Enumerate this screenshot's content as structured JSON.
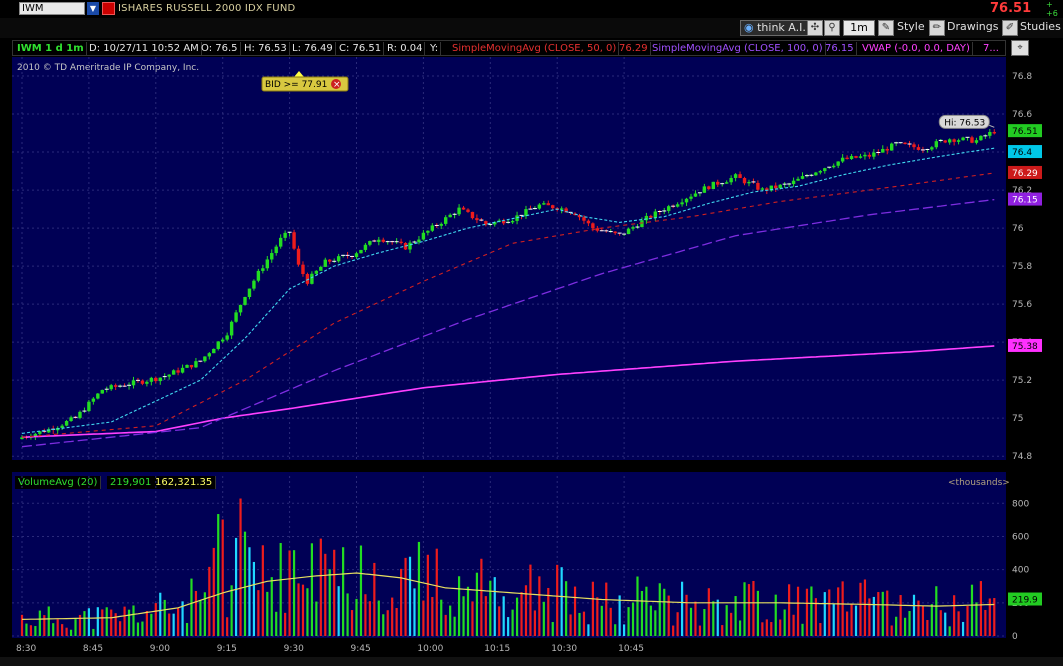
{
  "header": {
    "symbol": "IWM",
    "description": "ISHARES RUSSELL 2000 IDX FUND",
    "last_price": "76.51",
    "change_top": "+",
    "change_bottom": "+6"
  },
  "toolbar": {
    "think_label": "think A.I.",
    "timeframe": "1m",
    "style_label": "Style",
    "drawings_label": "Drawings",
    "studies_label": "Studies"
  },
  "infobar": {
    "aggregation": "IWM 1 d 1m",
    "date": "D: 10/27/11 10:52 AM",
    "open": "O: 76.5",
    "high": "H: 76.53",
    "low": "L: 76.49",
    "close": "C: 76.51",
    "range": "R: 0.04",
    "y": "Y:",
    "sma50_label": "SimpleMovingAvg (CLOSE, 50, 0)",
    "sma50_value": "76.29",
    "sma100_label": "SimpleMovingAvg (CLOSE, 100, 0)",
    "sma100_value": "76.15",
    "vwap_label": "VWAP (-0.0, 0.0, DAY)",
    "vwap_value": "7..."
  },
  "price_panel": {
    "copyright": "2010 © TD Ameritrade IP Company, Inc.",
    "alert_label": "BID >= 77.91",
    "hi_label": "Hi: 76.53",
    "tags": [
      {
        "text": "76.51",
        "price": 76.51,
        "bg": "#22cc22",
        "fg": "#000000"
      },
      {
        "text": "76.4",
        "price": 76.4,
        "bg": "#00c8e8",
        "fg": "#000000"
      },
      {
        "text": "76.29",
        "price": 76.29,
        "bg": "#cc1a1a",
        "fg": "#ffffff"
      },
      {
        "text": "76.15",
        "price": 76.15,
        "bg": "#9020e0",
        "fg": "#ffffff"
      },
      {
        "text": "75.38",
        "price": 75.38,
        "bg": "#ff30ff",
        "fg": "#000000"
      }
    ]
  },
  "volume_panel": {
    "study_label": "VolumeAvg (20)",
    "avg_value": "219,901",
    "volume_value": "162,321.35",
    "units_label": "<thousands>",
    "tag": {
      "text": "219.9",
      "value": 219.9
    }
  },
  "chart_data": {
    "type": "candlestick",
    "price_axis": {
      "ticks": [
        74.8,
        75,
        75.2,
        75.4,
        75.6,
        75.8,
        76,
        76.2,
        76.4,
        76.6,
        76.8
      ],
      "ylim": [
        74.78,
        76.9
      ]
    },
    "volume_axis": {
      "ticks": [
        0,
        200,
        400,
        600,
        800
      ],
      "ylim": [
        0,
        880
      ]
    },
    "time_ticks": [
      "8:30",
      "8:45",
      "9:00",
      "9:15",
      "9:30",
      "9:45",
      "10:00",
      "10:15",
      "10:30",
      "10:45"
    ],
    "bar_interval_minutes": 1,
    "first_bar_time": "8:30",
    "close_anchors": [
      [
        0,
        74.9
      ],
      [
        6,
        74.94
      ],
      [
        12,
        75.0
      ],
      [
        18,
        75.15
      ],
      [
        24,
        75.18
      ],
      [
        32,
        75.22
      ],
      [
        40,
        75.3
      ],
      [
        46,
        75.45
      ],
      [
        50,
        75.65
      ],
      [
        54,
        75.8
      ],
      [
        58,
        75.94
      ],
      [
        60,
        75.98
      ],
      [
        62,
        75.8
      ],
      [
        64,
        75.72
      ],
      [
        68,
        75.82
      ],
      [
        74,
        75.86
      ],
      [
        80,
        75.95
      ],
      [
        86,
        75.9
      ],
      [
        92,
        76.0
      ],
      [
        98,
        76.1
      ],
      [
        104,
        76.02
      ],
      [
        110,
        76.05
      ],
      [
        116,
        76.12
      ],
      [
        120,
        76.11
      ],
      [
        124,
        76.08
      ],
      [
        128,
        76.0
      ],
      [
        134,
        75.96
      ],
      [
        140,
        76.05
      ],
      [
        148,
        76.15
      ],
      [
        154,
        76.22
      ],
      [
        160,
        76.27
      ],
      [
        166,
        76.2
      ],
      [
        172,
        76.23
      ],
      [
        178,
        76.3
      ],
      [
        184,
        76.36
      ],
      [
        190,
        76.38
      ],
      [
        196,
        76.44
      ],
      [
        202,
        76.42
      ],
      [
        208,
        76.47
      ],
      [
        214,
        76.46
      ],
      [
        218,
        76.51
      ]
    ],
    "ema_anchors": [
      [
        0,
        74.92
      ],
      [
        20,
        74.98
      ],
      [
        40,
        75.2
      ],
      [
        50,
        75.42
      ],
      [
        60,
        75.68
      ],
      [
        70,
        75.8
      ],
      [
        80,
        75.87
      ],
      [
        90,
        75.93
      ],
      [
        100,
        76.0
      ],
      [
        110,
        76.05
      ],
      [
        120,
        76.1
      ],
      [
        126,
        76.06
      ],
      [
        134,
        76.03
      ],
      [
        144,
        76.06
      ],
      [
        154,
        76.13
      ],
      [
        164,
        76.19
      ],
      [
        174,
        76.22
      ],
      [
        184,
        76.28
      ],
      [
        194,
        76.33
      ],
      [
        204,
        76.37
      ],
      [
        212,
        76.4
      ],
      [
        218,
        76.42
      ]
    ],
    "sma50_anchors": [
      [
        0,
        74.9
      ],
      [
        30,
        74.96
      ],
      [
        50,
        75.2
      ],
      [
        70,
        75.5
      ],
      [
        90,
        75.72
      ],
      [
        110,
        75.92
      ],
      [
        130,
        76.0
      ],
      [
        150,
        76.06
      ],
      [
        170,
        76.14
      ],
      [
        190,
        76.2
      ],
      [
        218,
        76.29
      ]
    ],
    "sma100_anchors": [
      [
        0,
        74.85
      ],
      [
        40,
        74.95
      ],
      [
        70,
        75.25
      ],
      [
        100,
        75.52
      ],
      [
        130,
        75.76
      ],
      [
        160,
        75.96
      ],
      [
        190,
        76.07
      ],
      [
        218,
        76.15
      ]
    ],
    "vwap_anchors": [
      [
        0,
        74.9
      ],
      [
        30,
        74.93
      ],
      [
        45,
        75.0
      ],
      [
        60,
        75.05
      ],
      [
        90,
        75.16
      ],
      [
        120,
        75.23
      ],
      [
        160,
        75.3
      ],
      [
        200,
        75.35
      ],
      [
        218,
        75.38
      ]
    ],
    "volume_avg_anchors": [
      [
        0,
        100
      ],
      [
        20,
        110
      ],
      [
        35,
        170
      ],
      [
        45,
        260
      ],
      [
        55,
        330
      ],
      [
        65,
        360
      ],
      [
        75,
        380
      ],
      [
        85,
        350
      ],
      [
        95,
        290
      ],
      [
        110,
        260
      ],
      [
        130,
        220
      ],
      [
        150,
        200
      ],
      [
        170,
        200
      ],
      [
        190,
        190
      ],
      [
        205,
        180
      ],
      [
        218,
        190
      ]
    ]
  },
  "colors": {
    "background": "#000055",
    "grid": "#2a2a7a",
    "up": "#22dd22",
    "down": "#ee1c1c",
    "ema": "#40d8f0",
    "sma50": "#d02020",
    "sma100": "#7d2de0",
    "vwap": "#ff40ff",
    "volume_avg": "#e8e060",
    "volume_cyan": "#20d8ff"
  }
}
